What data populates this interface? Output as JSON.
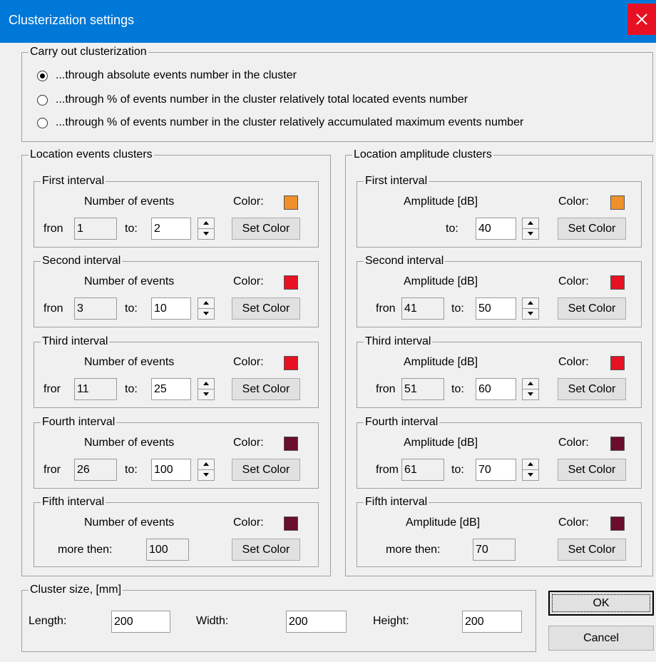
{
  "window": {
    "title": "Clusterization settings"
  },
  "mode": {
    "legend": "Carry out clusterization",
    "options": [
      {
        "label": "...through absolute events number in the cluster",
        "checked": true
      },
      {
        "label": "...through % of events number in the cluster relatively total located events number",
        "checked": false
      },
      {
        "label": "...through % of events number in the cluster relatively accumulated maximum events number",
        "checked": false
      }
    ]
  },
  "events": {
    "legend": "Location events clusters",
    "intervals": [
      {
        "legend": "First interval",
        "header": "Number of events",
        "color_label": "Color:",
        "color": "#f0902a",
        "from_label": "fron",
        "from": "1",
        "to_label": "to:",
        "to": "2",
        "set_color": "Set Color"
      },
      {
        "legend": "Second interval",
        "header": "Number of events",
        "color_label": "Color:",
        "color": "#e81123",
        "from_label": "fron",
        "from": "3",
        "to_label": "to:",
        "to": "10",
        "set_color": "Set Color"
      },
      {
        "legend": "Third interval",
        "header": "Number of events",
        "color_label": "Color:",
        "color": "#e81123",
        "from_label": "fror",
        "from": "11",
        "to_label": "to:",
        "to": "25",
        "set_color": "Set Color"
      },
      {
        "legend": "Fourth interval",
        "header": "Number of events",
        "color_label": "Color:",
        "color": "#6b0d2d",
        "from_label": "fror",
        "from": "26",
        "to_label": "to:",
        "to": "100",
        "set_color": "Set Color"
      },
      {
        "legend": "Fifth interval",
        "header": "Number of events",
        "color_label": "Color:",
        "color": "#6b0d2d",
        "more_label": "more then:",
        "more": "100",
        "set_color": "Set Color"
      }
    ]
  },
  "amplitude": {
    "legend": "Location amplitude clusters",
    "intervals": [
      {
        "legend": "First interval",
        "header": "Amplitude [dB]",
        "color_label": "Color:",
        "color": "#f0902a",
        "to_label": "to:",
        "to": "40",
        "set_color": "Set Color"
      },
      {
        "legend": "Second interval",
        "header": "Amplitude [dB]",
        "color_label": "Color:",
        "color": "#e81123",
        "from_label": "fron",
        "from": "41",
        "to_label": "to:",
        "to": "50",
        "set_color": "Set Color"
      },
      {
        "legend": "Third interval",
        "header": "Amplitude [dB]",
        "color_label": "Color:",
        "color": "#e81123",
        "from_label": "fron",
        "from": "51",
        "to_label": "to:",
        "to": "60",
        "set_color": "Set Color"
      },
      {
        "legend": "Fourth interval",
        "header": "Amplitude [dB]",
        "color_label": "Color:",
        "color": "#6b0d2d",
        "from_label": "from",
        "from": "61",
        "to_label": "to:",
        "to": "70",
        "set_color": "Set Color"
      },
      {
        "legend": "Fifth interval",
        "header": "Amplitude [dB]",
        "color_label": "Color:",
        "color": "#6b0d2d",
        "more_label": "more then:",
        "more": "70",
        "set_color": "Set Color"
      }
    ]
  },
  "cluster_size": {
    "legend": "Cluster size, [mm]",
    "length_label": "Length:",
    "length": "200",
    "width_label": "Width:",
    "width": "200",
    "height_label": "Height:",
    "height": "200"
  },
  "buttons": {
    "ok": "OK",
    "cancel": "Cancel"
  }
}
